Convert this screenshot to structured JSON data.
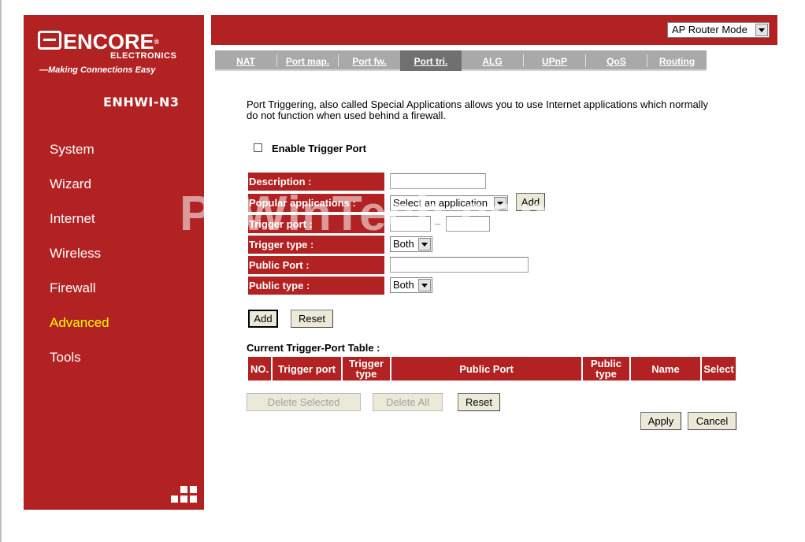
{
  "brand": {
    "logo_word": "ENCORE",
    "logo_sub": "ELECTRONICS",
    "logo_reg": "®",
    "tagline": "—Making Connections Easy",
    "model": "ENHWI-N3"
  },
  "sidebar": {
    "items": [
      {
        "label": "System"
      },
      {
        "label": "Wizard"
      },
      {
        "label": "Internet"
      },
      {
        "label": "Wireless"
      },
      {
        "label": "Firewall"
      },
      {
        "label": "Advanced"
      },
      {
        "label": "Tools"
      }
    ],
    "active": "Advanced"
  },
  "header": {
    "mode_value": "AP Router Mode"
  },
  "tabs": [
    {
      "label": "NAT"
    },
    {
      "label": "Port map."
    },
    {
      "label": "Port fw."
    },
    {
      "label": "Port tri."
    },
    {
      "label": "ALG"
    },
    {
      "label": "UPnP"
    },
    {
      "label": "QoS"
    },
    {
      "label": "Routing"
    }
  ],
  "active_tab": "Port tri.",
  "content": {
    "description": "Port Triggering, also called Special Applications allows you to use Internet applications which normally do not function when used behind a firewall.",
    "enable_label": "Enable Trigger Port",
    "form": {
      "description_label": "Description :",
      "popular_label": "Popular applications :",
      "popular_value": "Select an application",
      "popular_add": "Add",
      "trigger_port_label": "Trigger port :",
      "trigger_port_sep": "~",
      "trigger_type_label": "Trigger type :",
      "trigger_type_value": "Both",
      "public_port_label": "Public Port :",
      "public_type_label": "Public type :",
      "public_type_value": "Both"
    },
    "buttons": {
      "add": "Add",
      "reset": "Reset"
    },
    "table": {
      "title": "Current Trigger-Port Table :",
      "headers": [
        "NO.",
        "Trigger port",
        "Trigger type",
        "Public Port",
        "Public type",
        "Name",
        "Select"
      ]
    },
    "table_buttons": {
      "delete_selected": "Delete Selected",
      "delete_all": "Delete All",
      "reset": "Reset"
    },
    "footer_buttons": {
      "apply": "Apply",
      "cancel": "Cancel"
    }
  },
  "watermark": "PcWinTech.com",
  "colors": {
    "brand_red": "#b22222",
    "active_nav": "#ffff00",
    "tab_bg": "#a9a9a9",
    "tab_active": "#707070"
  }
}
